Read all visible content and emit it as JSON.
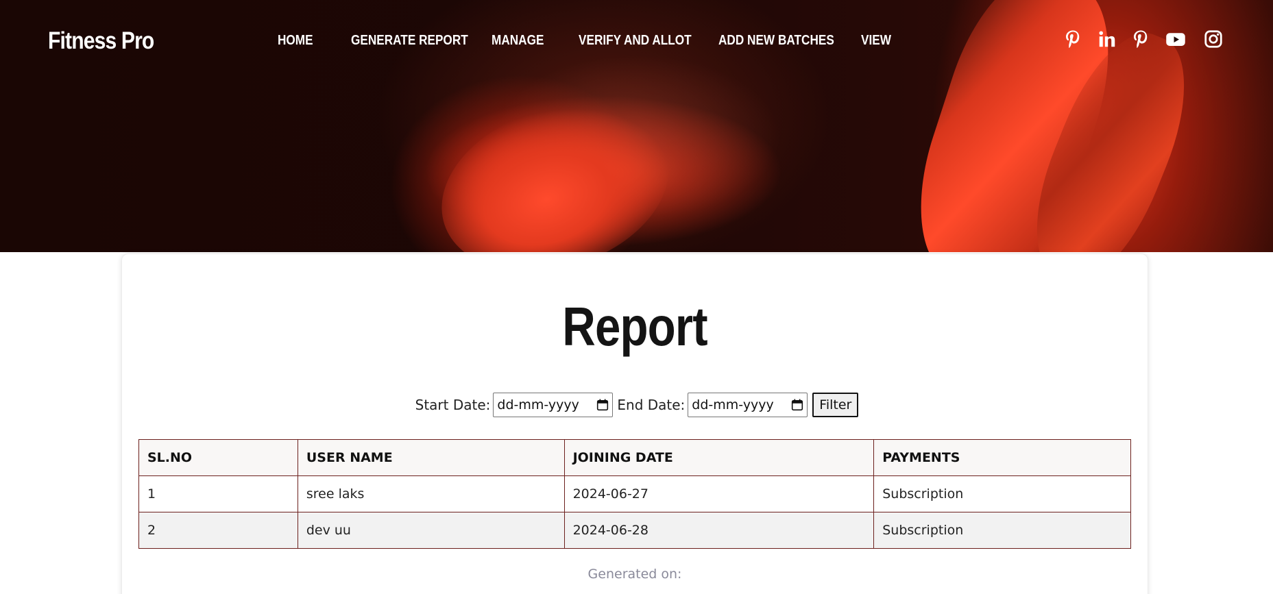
{
  "brand": {
    "name": "Fitness Pro"
  },
  "nav": {
    "items": [
      {
        "label": "HOME"
      },
      {
        "label": "GENERATE REPORT"
      },
      {
        "label": "MANAGE"
      },
      {
        "label": "VERIFY AND ALLOT"
      },
      {
        "label": "ADD NEW BATCHES"
      },
      {
        "label": "VIEW"
      }
    ]
  },
  "social": {
    "icons": [
      "pinterest-icon",
      "linkedin-icon",
      "pinterest-icon",
      "youtube-icon",
      "instagram-icon"
    ]
  },
  "report": {
    "title": "Report",
    "filter": {
      "start_label": "Start Date:",
      "start_placeholder": "dd-mm-yyyy",
      "end_label": "End Date:",
      "end_placeholder": "dd-mm-yyyy",
      "button_label": "Filter"
    },
    "table": {
      "headers": [
        "SL.NO",
        "USER NAME",
        "JOINING DATE",
        "PAYMENTS"
      ],
      "rows": [
        [
          "1",
          "sree laks",
          "2024-06-27",
          "Subscription"
        ],
        [
          "2",
          "dev uu",
          "2024-06-28",
          "Subscription"
        ]
      ]
    },
    "generated_label": "Generated on:"
  },
  "colors": {
    "hero_dark": "#1a0604",
    "hero_accent": "#ff4a2a",
    "table_border": "#6b1f1c",
    "generated_text": "#8a8a9a"
  }
}
